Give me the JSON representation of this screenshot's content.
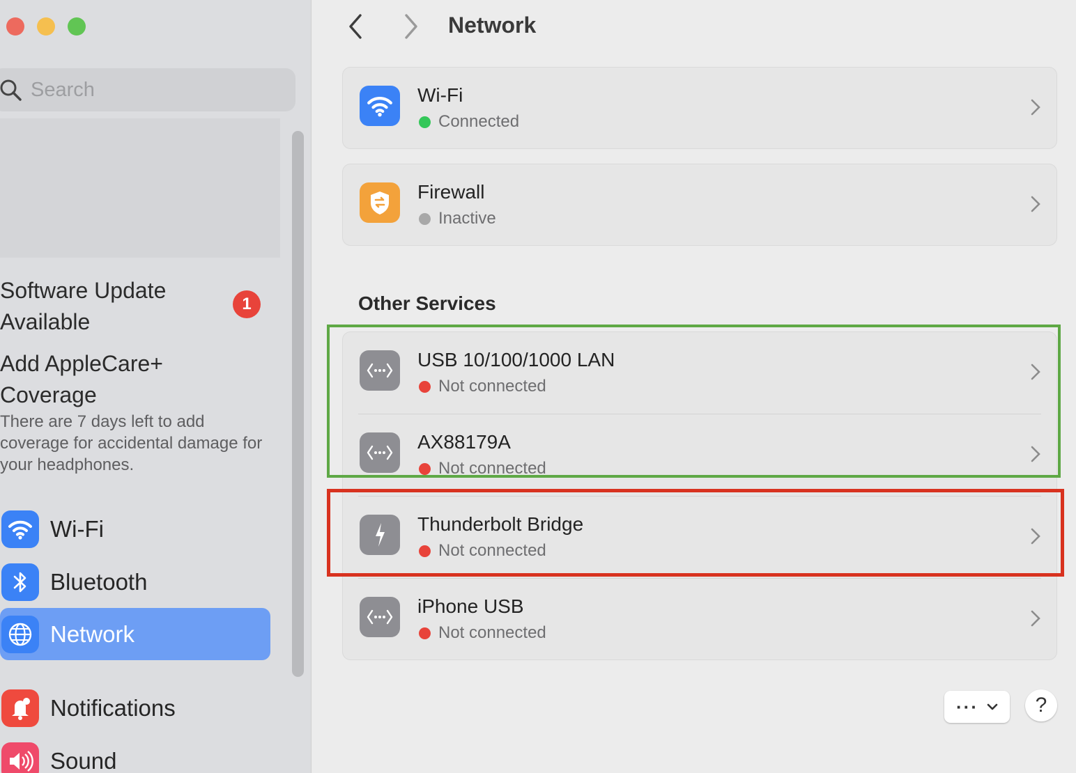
{
  "window": {
    "title": "Network"
  },
  "sidebar": {
    "search_placeholder": "Search",
    "software_update": {
      "label": "Software Update Available",
      "badge": "1"
    },
    "applecare": {
      "title": "Add AppleCare+ Coverage",
      "description": "There are 7 days left to add coverage for accidental damage for your headphones."
    },
    "items": [
      {
        "label": "Wi-Fi",
        "icon": "wifi-icon"
      },
      {
        "label": "Bluetooth",
        "icon": "bluetooth-icon"
      },
      {
        "label": "Network",
        "icon": "globe-icon",
        "selected": true
      },
      {
        "label": "Notifications",
        "icon": "bell-icon"
      },
      {
        "label": "Sound",
        "icon": "speaker-icon"
      }
    ]
  },
  "main": {
    "title": "Network",
    "primary_services": [
      {
        "name": "Wi-Fi",
        "status": "Connected",
        "status_color": "#34c759",
        "icon": "wifi-icon"
      },
      {
        "name": "Firewall",
        "status": "Inactive",
        "status_color": "#a8a8a8",
        "icon": "firewall-icon"
      }
    ],
    "other_services_title": "Other Services",
    "other_services": [
      {
        "name": "USB 10/100/1000 LAN",
        "status": "Not connected",
        "status_color": "#e8433a",
        "icon": "ethernet-icon"
      },
      {
        "name": "AX88179A",
        "status": "Not connected",
        "status_color": "#e8433a",
        "icon": "ethernet-icon"
      },
      {
        "name": "Thunderbolt Bridge",
        "status": "Not connected",
        "status_color": "#e8433a",
        "icon": "thunderbolt-icon"
      },
      {
        "name": "iPhone USB",
        "status": "Not connected",
        "status_color": "#e8433a",
        "icon": "ethernet-icon"
      }
    ],
    "more_button_label": "···",
    "help_button_label": "?"
  },
  "highlights": {
    "green": "#5ea845",
    "red": "#d8321f"
  }
}
